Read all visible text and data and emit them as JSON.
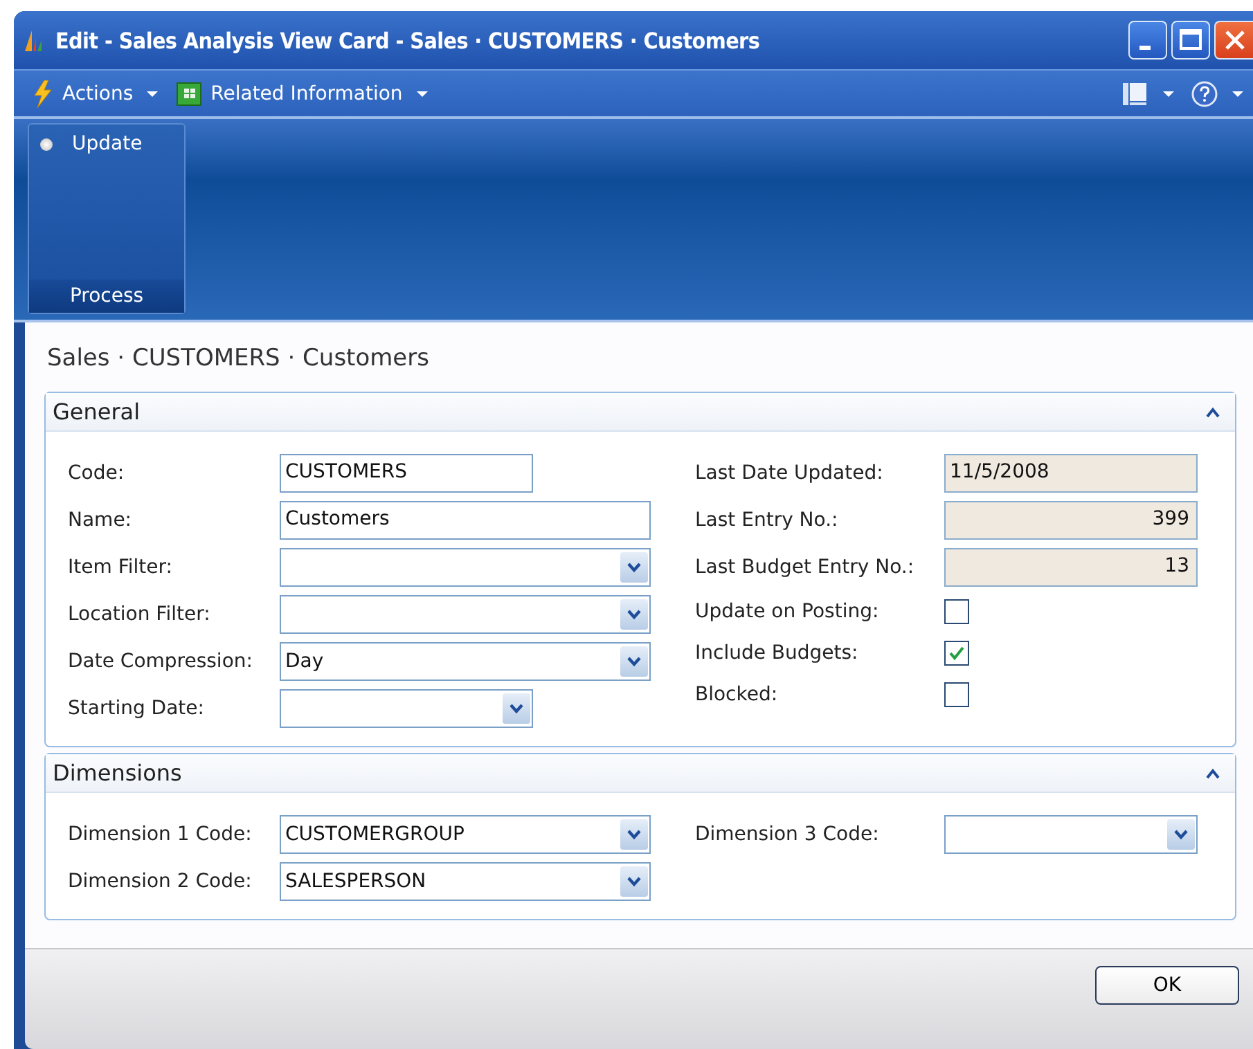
{
  "window": {
    "title": "Edit - Sales Analysis View Card - Sales · CUSTOMERS · Customers"
  },
  "menu": [
    {
      "label": "Actions",
      "kind": "actions"
    },
    {
      "label": "Related Information",
      "kind": "related"
    }
  ],
  "ribbon": {
    "groups": [
      {
        "name": "Process",
        "actions": [
          "Update"
        ]
      }
    ]
  },
  "page_title": "Sales · CUSTOMERS · Customers",
  "sections": [
    {
      "title": "General",
      "expanded": true,
      "left": [
        {
          "label": "Code:",
          "kind": "text",
          "value": "CUSTOMERS"
        },
        {
          "label": "Name:",
          "kind": "text",
          "value": "Customers"
        },
        {
          "label": "Item Filter:",
          "kind": "dropdown"
        },
        {
          "label": "Location Filter:",
          "kind": "dropdown"
        },
        {
          "label": "Date Compression:",
          "kind": "dropdown",
          "value": "Day"
        },
        {
          "label": "Starting Date:",
          "kind": "dropdown"
        }
      ],
      "right": [
        {
          "label": "Last Date Updated:",
          "kind": "readonly",
          "value": "11/5/2008"
        },
        {
          "label": "Last Entry No.:",
          "kind": "number",
          "value": "399"
        },
        {
          "label": "Last Budget Entry No.:",
          "kind": "number",
          "value": "13"
        },
        {
          "label": "Update on Posting:",
          "kind": "checkbox",
          "checked": false
        },
        {
          "label": "Include Budgets:",
          "kind": "checkbox",
          "checked": true
        },
        {
          "label": "Blocked:",
          "kind": "checkbox",
          "checked": false
        }
      ]
    },
    {
      "title": "Dimensions",
      "expanded": true,
      "left": [
        {
          "label": "Dimension 1 Code:",
          "kind": "dropdown",
          "value": "CUSTOMERGROUP"
        },
        {
          "label": "Dimension 2 Code:",
          "kind": "dropdown",
          "value": "SALESPERSON"
        }
      ],
      "right": [
        {
          "label": "Dimension 3 Code:",
          "kind": "dropdown"
        }
      ]
    }
  ],
  "buttons": [
    "OK"
  ]
}
